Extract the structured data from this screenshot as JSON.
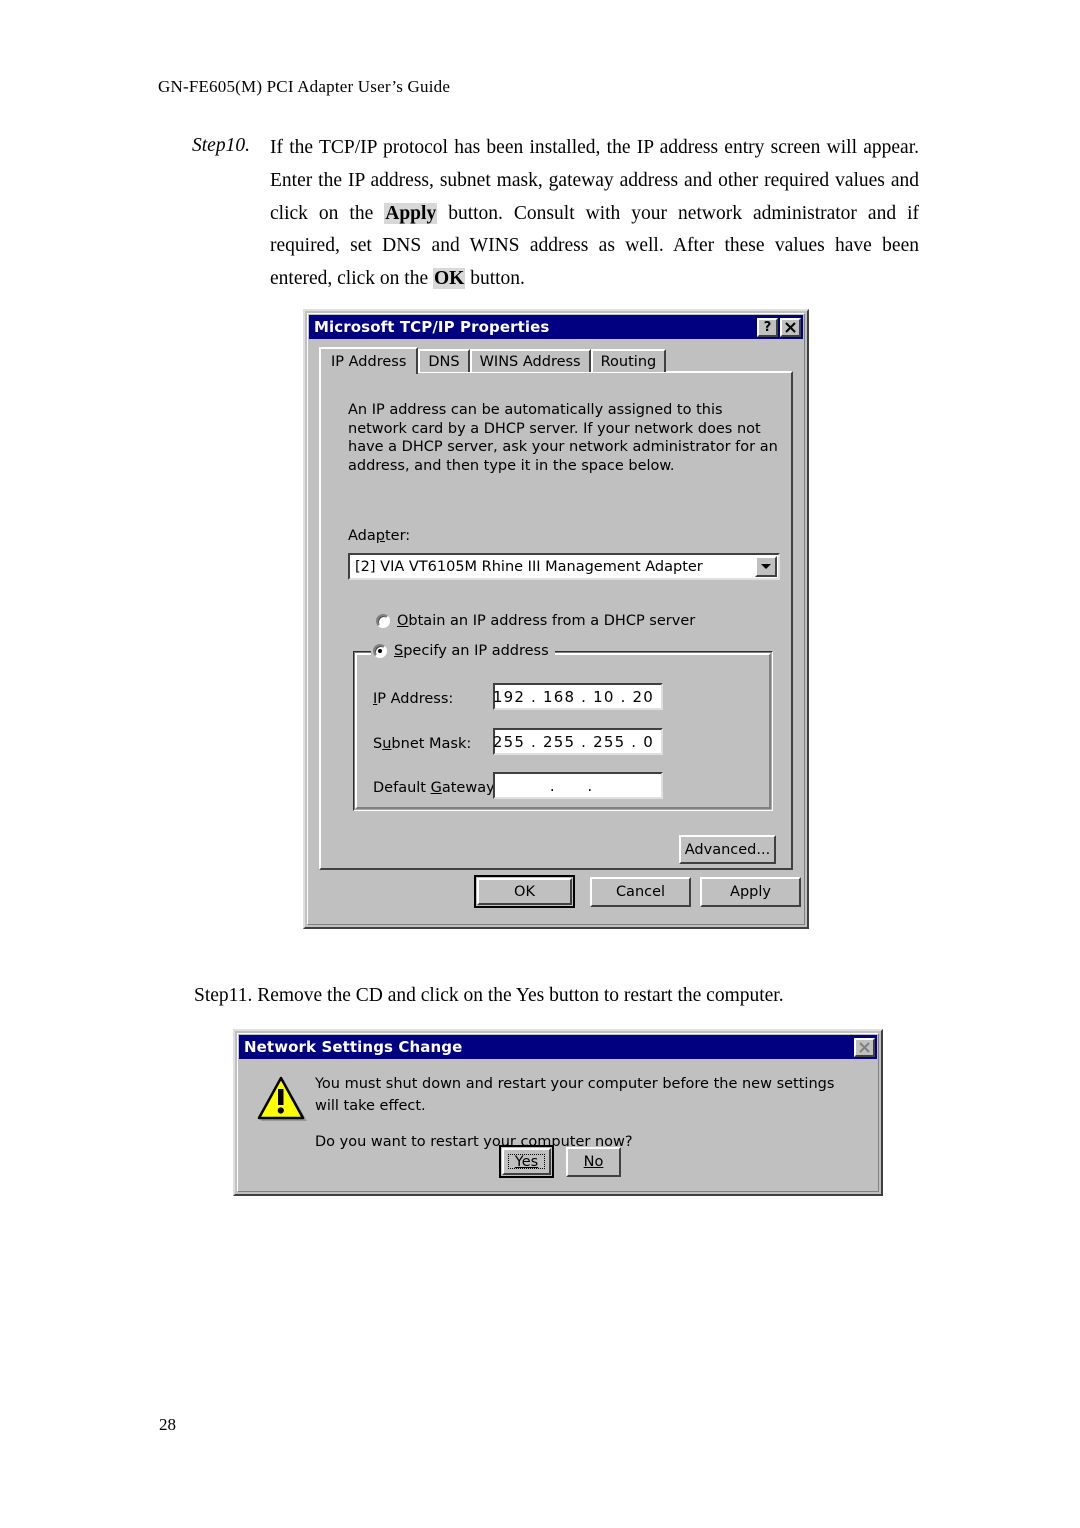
{
  "document": {
    "header": "GN-FE605(M) PCI Adapter User’s Guide",
    "page_number": "28",
    "step10": {
      "label": "Step10.",
      "line1": "If the TCP/IP protocol has been installed, the IP address entry screen",
      "line2": "will appear. Enter the IP address, subnet mask, gateway address and",
      "line3a": "other required values and click on the ",
      "line3_bold": "Apply",
      "line3b": " button. Consult with your",
      "line4": "network administrator and if required, set DNS and WINS address as",
      "line5a": "well. After these values have been entered, click on the ",
      "line5_bold": "OK",
      "line5b": " button."
    },
    "step11": "Step11. Remove the CD and click on the Yes button to restart the computer."
  },
  "tcpip_dialog": {
    "title": "Microsoft TCP/IP Properties",
    "help_button": "?",
    "close_button": "✕",
    "tabs": [
      {
        "label": "IP Address",
        "active": true
      },
      {
        "label": "DNS",
        "active": false
      },
      {
        "label": "WINS Address",
        "active": false
      },
      {
        "label": "Routing",
        "active": false
      }
    ],
    "description": "An IP address can be automatically assigned to this network card by a DHCP server.  If your network does not have a DHCP server, ask your network administrator for an address, and then type it in the space below.",
    "adapter_label": "Adapter:",
    "adapter_value": "[2] VIA VT6105M Rhine III Management Adapter",
    "radio_dhcp_label": "Obtain an IP address from a DHCP server",
    "radio_dhcp_selected": false,
    "radio_specify_label": "Specify an IP address",
    "radio_specify_selected": true,
    "ip_address_label": "IP Address:",
    "ip_address_value": "192 . 168 .  10 .  20",
    "subnet_mask_label": "Subnet Mask:",
    "subnet_mask_value": "255 . 255 . 255 .   0",
    "default_gateway_label": "Default Gateway:",
    "default_gateway_value": "    .        .",
    "advanced_button": "Advanced...",
    "ok_button": "OK",
    "cancel_button": "Cancel",
    "apply_button": "Apply"
  },
  "network_dialog": {
    "title": "Network Settings Change",
    "close_button": "✕",
    "message_line1": "You must shut down and restart your computer before the new settings will take effect.",
    "message_line2": "Do you want to restart your computer now?",
    "yes_button": "Yes",
    "no_button": "No",
    "icon": "warning-triangle"
  },
  "colors": {
    "title_bar": "#000080",
    "dialog_face": "#c0c0c0",
    "warning_yellow": "#ffff00",
    "highlight_gray": "#d8d8d8"
  }
}
